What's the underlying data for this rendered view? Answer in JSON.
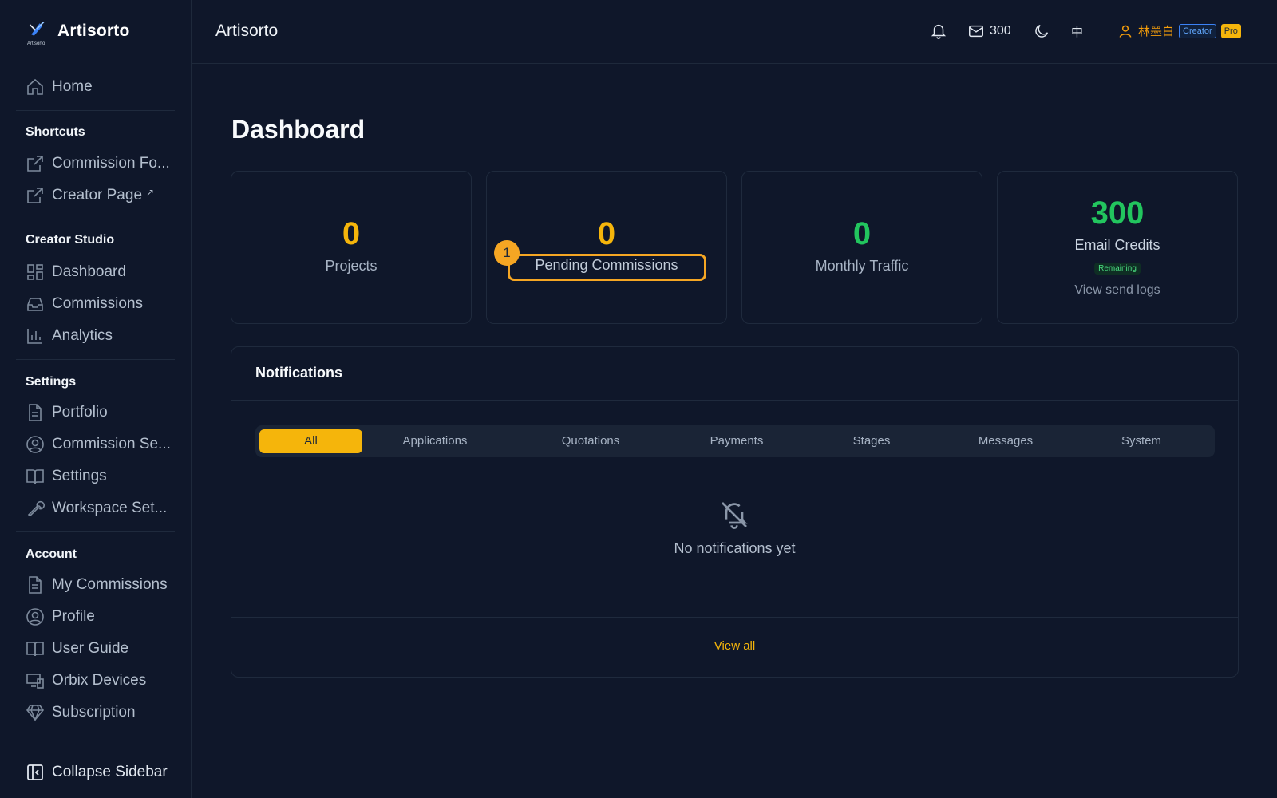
{
  "brand": {
    "name": "Artisorto",
    "logo_caption": "Artisorto"
  },
  "sidebar": {
    "home": "Home",
    "sections": {
      "shortcuts": "Shortcuts",
      "creator_studio": "Creator Studio",
      "settings": "Settings",
      "account": "Account"
    },
    "shortcuts": [
      {
        "label": "Commission Fo...",
        "icon": "external-link-icon"
      },
      {
        "label": "Creator Page",
        "icon": "external-link-icon",
        "suffix": "↗"
      }
    ],
    "creator_studio": [
      {
        "label": "Dashboard",
        "icon": "dashboard-icon"
      },
      {
        "label": "Commissions",
        "icon": "inbox-icon"
      },
      {
        "label": "Analytics",
        "icon": "bar-chart-icon"
      }
    ],
    "settings": [
      {
        "label": "Portfolio",
        "icon": "document-icon"
      },
      {
        "label": "Commission Se...",
        "icon": "user-circle-icon"
      },
      {
        "label": "Settings",
        "icon": "book-icon"
      },
      {
        "label": "Workspace Set...",
        "icon": "wrench-icon"
      }
    ],
    "account": [
      {
        "label": "My Commissions",
        "icon": "document-icon"
      },
      {
        "label": "Profile",
        "icon": "user-circle-icon"
      },
      {
        "label": "User Guide",
        "icon": "book-icon"
      },
      {
        "label": "Orbix Devices",
        "icon": "devices-icon"
      },
      {
        "label": "Subscription",
        "icon": "diamond-icon"
      }
    ],
    "collapse": "Collapse Sidebar"
  },
  "header": {
    "title": "Artisorto",
    "mail_count": "300",
    "language": "中",
    "user_name": "林墨白",
    "badge_creator": "Creator",
    "badge_pro": "Pro"
  },
  "dashboard": {
    "title": "Dashboard",
    "stats": {
      "projects": {
        "value": "0",
        "label": "Projects"
      },
      "pending": {
        "value": "0",
        "label": "Pending Commissions",
        "marker": "1"
      },
      "traffic": {
        "value": "0",
        "label": "Monthly Traffic"
      },
      "credits": {
        "value": "300",
        "label": "Email Credits",
        "badge": "Remaining",
        "link": "View send logs"
      }
    }
  },
  "notifications": {
    "title": "Notifications",
    "tabs": [
      "All",
      "Applications",
      "Quotations",
      "Payments",
      "Stages",
      "Messages",
      "System"
    ],
    "active_tab": "All",
    "empty_text": "No notifications yet",
    "view_all": "View all"
  },
  "colors": {
    "accent": "#f5b50b",
    "success": "#22c55e",
    "background": "#0f172a",
    "highlight": "#f5a623"
  }
}
